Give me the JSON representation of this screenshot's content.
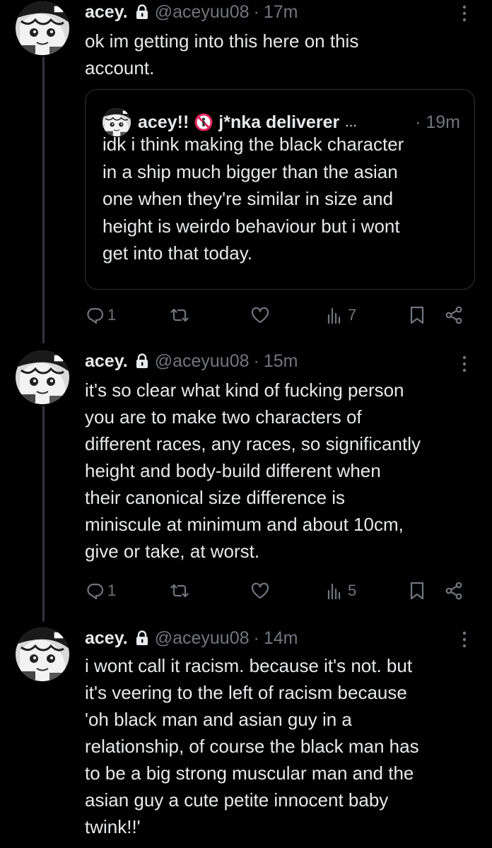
{
  "tweets": [
    {
      "name": "acey.",
      "handle": "@aceyuu08",
      "dot": "·",
      "time": "17m",
      "text": "ok im getting into this here on this\naccount.",
      "quote": {
        "name": "acey!!",
        "handle": "j*nka deliverer",
        "ellipsis": "...",
        "time": "· 19m",
        "text": "idk i think making the black character\nin a ship much bigger than the asian\none when they're similar in size and\nheight is weirdo behaviour but i wont\nget into that today."
      },
      "replies": "1",
      "views": "7"
    },
    {
      "name": "acey.",
      "handle": "@aceyuu08",
      "dot": "·",
      "time": "15m",
      "text": "it's so clear what kind of fucking person\nyou are to make two characters of\ndifferent races, any races, so significantly\nheight and body-build different when\ntheir canonical size difference is\nminiscule at minimum and about 10cm,\ngive or take, at worst.",
      "replies": "1",
      "views": "5"
    },
    {
      "name": "acey.",
      "handle": "@aceyuu08",
      "dot": "·",
      "time": "14m",
      "text": "i wont call it racism. because it's not. but\nit's veering to the left of racism because\n'oh black man and asian guy in a\nrelationship, of course the black man has\nto be a big strong muscular man and the\nasian guy a cute petite innocent baby\ntwink!!'"
    }
  ],
  "icons": {
    "lock": "lock-icon",
    "more": "more-icon",
    "reply": "reply-icon",
    "retweet": "retweet-icon",
    "like": "heart-icon",
    "views": "views-icon",
    "bookmark": "bookmark-icon",
    "share": "share-icon",
    "noentry": "no-entry-icon"
  },
  "colors": {
    "background": "#000000",
    "text": "#e7e9ea",
    "muted": "#71767b",
    "border": "#2f3336"
  }
}
